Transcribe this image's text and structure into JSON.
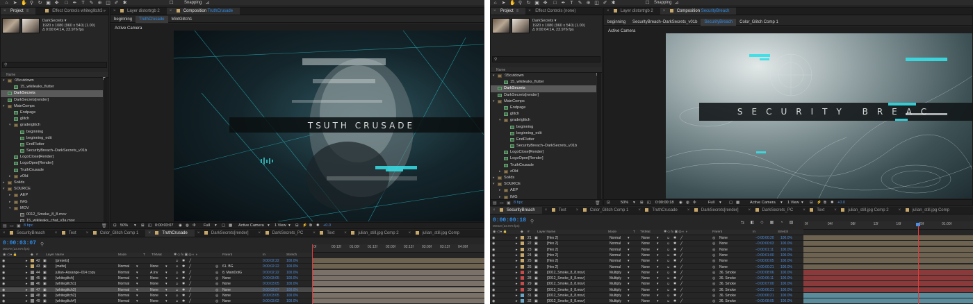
{
  "toolbar": {
    "snapping_label": "Snapping"
  },
  "left": {
    "project": {
      "tabs": [
        {
          "label": "Project",
          "active": true
        },
        {
          "label": "Effect Controls whiteglitch3",
          "active": false
        }
      ],
      "selected_item": "DarkSecrets ▾",
      "item_meta": [
        "1920 x 1080  (960 x 540) (1.00)",
        "Δ 0:00:04:14, 23.976 fps"
      ],
      "name_header": "Name",
      "tree": [
        {
          "depth": 0,
          "type": "folder",
          "twirl": "▾",
          "name": ":15cutdown"
        },
        {
          "depth": 1,
          "type": "comp",
          "twirl": "",
          "name": "15_wikileaks_flutter"
        },
        {
          "depth": 0,
          "type": "comp",
          "twirl": "",
          "name": "DarkSecrets",
          "selected": true
        },
        {
          "depth": 0,
          "type": "comp",
          "twirl": "",
          "name": "DarkSecrets[render]"
        },
        {
          "depth": 0,
          "type": "folder",
          "twirl": "▾",
          "name": "MainComps"
        },
        {
          "depth": 1,
          "type": "comp",
          "twirl": "",
          "name": "Endpage"
        },
        {
          "depth": 1,
          "type": "comp",
          "twirl": "",
          "name": "glitch"
        },
        {
          "depth": 1,
          "type": "folder",
          "twirl": "▾",
          "name": "grade/glitch"
        },
        {
          "depth": 2,
          "type": "comp",
          "twirl": "",
          "name": "beginning"
        },
        {
          "depth": 2,
          "type": "comp",
          "twirl": "",
          "name": "beginning_edit"
        },
        {
          "depth": 2,
          "type": "comp",
          "twirl": "",
          "name": "EndFlutter"
        },
        {
          "depth": 2,
          "type": "comp",
          "twirl": "",
          "name": "SecurityBreach–DarkSecrets_v01b"
        },
        {
          "depth": 1,
          "type": "comp",
          "twirl": "",
          "name": "LogoClose[Render]"
        },
        {
          "depth": 1,
          "type": "comp",
          "twirl": "",
          "name": "LogoOpen[Render]"
        },
        {
          "depth": 1,
          "type": "comp",
          "twirl": "",
          "name": "TruthCrusade"
        },
        {
          "depth": 1,
          "type": "folder",
          "twirl": "▸",
          "name": "zOld"
        },
        {
          "depth": 0,
          "type": "folder",
          "twirl": "▸",
          "name": "Solids"
        },
        {
          "depth": 0,
          "type": "folder",
          "twirl": "▾",
          "name": "SOURCE"
        },
        {
          "depth": 1,
          "type": "folder",
          "twirl": "▸",
          "name": "AEP"
        },
        {
          "depth": 1,
          "type": "folder",
          "twirl": "▸",
          "name": "IMG"
        },
        {
          "depth": 1,
          "type": "folder",
          "twirl": "▾",
          "name": "MOV"
        },
        {
          "depth": 2,
          "type": "footage",
          "twirl": "",
          "name": "0012_Smoke_8_8.mov"
        },
        {
          "depth": 2,
          "type": "footage",
          "twirl": "",
          "name": "15_wikileaks_chat_v3a.mov"
        }
      ],
      "bpc": "8 bpc"
    },
    "viewer": {
      "tabs": [
        {
          "label": "Layer distortrgb 2",
          "active": false,
          "comp": false
        },
        {
          "label": "Composition ",
          "hl": "TruthCrusade",
          "active": true,
          "comp": true
        }
      ],
      "breadcrumbs": [
        {
          "label": "beginning",
          "current": false
        },
        {
          "label": "TruthCrusade",
          "current": true
        },
        {
          "label": "MintGlitch1",
          "current": false
        }
      ],
      "camera_label": "Active Camera",
      "title_text": "TSUTH CRUSADE",
      "footer": {
        "zoom": "50%",
        "timecode": "0:00:03:07",
        "resolution": "Full",
        "camera": "Active Camera",
        "views": "1 View",
        "exposure": "+0.0"
      }
    },
    "timeline": {
      "tabs": [
        {
          "label": "SecurityBreach",
          "color": "#c8a86a",
          "active": false
        },
        {
          "label": "Text",
          "color": "#c8a86a",
          "active": false
        },
        {
          "label": "Color_Glitch Comp 1",
          "color": "#c8a86a",
          "active": false
        },
        {
          "label": "TruthCrusade",
          "color": "#c8a86a",
          "active": true
        },
        {
          "label": "DarkSecrets[render]",
          "color": "#c8a86a",
          "active": false
        },
        {
          "label": "DarkSecrets_PC",
          "color": "#c8a86a",
          "active": false
        },
        {
          "label": "Text",
          "color": "#c8a86a",
          "active": false
        },
        {
          "label": "julian_still.jpg Comp 2",
          "color": "#c8a86a",
          "active": false
        },
        {
          "label": "julian_still.jpg Comp",
          "color": "#c8a86a",
          "active": false
        }
      ],
      "timecode": "0:00:03:07",
      "frames": "00079 (23.976 fps)",
      "columns": {
        "name": "Layer Name",
        "mode": "Mode",
        "t": "T",
        "trkmat": "TrkMat",
        "parent": "Parent",
        "in": "In",
        "stretch": "Stretch"
      },
      "ruler": [
        "0f",
        "00:12f",
        "01:00f",
        "01:12f",
        "02:00f",
        "02:12f",
        "03:00f",
        "03:12f",
        "04:00f"
      ],
      "layers": [
        {
          "num": "42",
          "label": "#c8a86a",
          "name": "[presets]",
          "mode": "",
          "trk": "",
          "parent": "",
          "in": "0:00:02:22",
          "stretch": "100.0%",
          "color": "#6e6250"
        },
        {
          "num": "43",
          "label": "#c8a86a",
          "name": "[matte]",
          "mode": "Normal",
          "trk": "None",
          "parent": "61. BG",
          "in": "0:00:02:22",
          "stretch": "100.0%",
          "color": "#6e6250"
        },
        {
          "num": "44",
          "label": "#8a8a8a",
          "name": "julian–Assange–014 copy",
          "mode": "Normal",
          "trk": "A.Inv",
          "parent": "8. MainDotG",
          "in": "0:00:02:22",
          "stretch": "100.0%",
          "color": "#7a7268"
        },
        {
          "num": "45",
          "label": "#8a8a8a",
          "name": "[whiteglitch]",
          "mode": "Normal",
          "trk": "None",
          "parent": "None",
          "in": "0:00:03:05",
          "stretch": "100.0%",
          "color": "#7a7268"
        },
        {
          "num": "46",
          "label": "#8a8a8a",
          "name": "[whiteglitch1]",
          "mode": "Normal",
          "trk": "None",
          "parent": "None",
          "in": "0:00:03:05",
          "stretch": "100.0%",
          "color": "#7a7268"
        },
        {
          "num": "47",
          "label": "#8a8a8a",
          "name": "[whiteglitch3]",
          "mode": "Normal",
          "trk": "None",
          "parent": "None",
          "in": "0:00:03:07",
          "stretch": "100.0%",
          "color": "#8c8478",
          "selected": true
        },
        {
          "num": "48",
          "label": "#8a8a8a",
          "name": "[whiteglitch2]",
          "mode": "Normal",
          "trk": "None",
          "parent": "None",
          "in": "0:00:03:05",
          "stretch": "100.0%",
          "color": "#7a7268"
        },
        {
          "num": "49",
          "label": "#8a8a8a",
          "name": "[whiteglitch4]",
          "mode": "Normal",
          "trk": "None",
          "parent": "None",
          "in": "0:00:03:02",
          "stretch": "100.0%",
          "color": "#7a7268"
        }
      ]
    }
  },
  "right": {
    "project": {
      "tabs": [
        {
          "label": "Project",
          "active": true
        },
        {
          "label": "Effect Controls (none)",
          "active": false
        }
      ],
      "selected_item": "DarkSecrets ▾",
      "item_meta": [
        "1920 x 1080  (960 x 540) (1.00)",
        "Δ 0:00:04:14, 23.976 fps"
      ],
      "name_header": "Name",
      "tree": [
        {
          "depth": 0,
          "type": "folder",
          "twirl": "▾",
          "name": ":15cutdown"
        },
        {
          "depth": 1,
          "type": "comp",
          "twirl": "",
          "name": "15_wikileaks_flutter"
        },
        {
          "depth": 0,
          "type": "comp",
          "twirl": "",
          "name": "DarkSecrets",
          "selected": true
        },
        {
          "depth": 0,
          "type": "comp",
          "twirl": "",
          "name": "DarkSecrets[render]"
        },
        {
          "depth": 0,
          "type": "folder",
          "twirl": "▾",
          "name": "MainComps"
        },
        {
          "depth": 1,
          "type": "comp",
          "twirl": "",
          "name": "Endpage"
        },
        {
          "depth": 1,
          "type": "comp",
          "twirl": "",
          "name": "glitch"
        },
        {
          "depth": 1,
          "type": "folder",
          "twirl": "▾",
          "name": "grade/glitch"
        },
        {
          "depth": 2,
          "type": "comp",
          "twirl": "",
          "name": "beginning"
        },
        {
          "depth": 2,
          "type": "comp",
          "twirl": "",
          "name": "beginning_edit"
        },
        {
          "depth": 2,
          "type": "comp",
          "twirl": "",
          "name": "EndFlutter"
        },
        {
          "depth": 2,
          "type": "comp",
          "twirl": "",
          "name": "SecurityBreach–DarkSecrets_v01b"
        },
        {
          "depth": 1,
          "type": "comp",
          "twirl": "",
          "name": "LogoClose[Render]"
        },
        {
          "depth": 1,
          "type": "comp",
          "twirl": "",
          "name": "LogoOpen[Render]"
        },
        {
          "depth": 1,
          "type": "comp",
          "twirl": "",
          "name": "TruthCrusade"
        },
        {
          "depth": 1,
          "type": "folder",
          "twirl": "▸",
          "name": "zOld"
        },
        {
          "depth": 0,
          "type": "folder",
          "twirl": "▸",
          "name": "Solids"
        },
        {
          "depth": 0,
          "type": "folder",
          "twirl": "▾",
          "name": "SOURCE"
        },
        {
          "depth": 1,
          "type": "folder",
          "twirl": "▸",
          "name": "AEP"
        },
        {
          "depth": 1,
          "type": "folder",
          "twirl": "▸",
          "name": "IMG"
        }
      ],
      "bpc": "8 bpc"
    },
    "viewer": {
      "tabs": [
        {
          "label": "Layer distortrgb 2",
          "active": false,
          "comp": false
        },
        {
          "label": "Composition ",
          "hl": "SecurityBreach",
          "active": true,
          "comp": true
        }
      ],
      "breadcrumbs": [
        {
          "label": "beginning",
          "current": false
        },
        {
          "label": "SecurityBreach–DarkSecrets_v01b",
          "current": false
        },
        {
          "label": "SecurityBreach",
          "current": true
        },
        {
          "label": "Color_Glitch Comp 1",
          "current": false
        }
      ],
      "camera_label": "Active Camera",
      "title_text": "SECURITY BREAC",
      "footer": {
        "zoom": "50%",
        "timecode": "0:00:00:18",
        "resolution": "Full",
        "camera": "Active Camera",
        "views": "1 View",
        "exposure": "+0.0"
      }
    },
    "timeline": {
      "tabs": [
        {
          "label": "SecurityBreach",
          "color": "#c8a86a",
          "active": true
        },
        {
          "label": "Text",
          "color": "#c8a86a",
          "active": false
        },
        {
          "label": "Color_Glitch Comp 1",
          "color": "#c8a86a",
          "active": false
        },
        {
          "label": "TruthCrusade",
          "color": "#c8a86a",
          "active": false
        },
        {
          "label": "DarkSecrets[render]",
          "color": "#c8a86a",
          "active": false
        },
        {
          "label": "DarkSecrets_PC",
          "color": "#c8a86a",
          "active": false
        },
        {
          "label": "Text",
          "color": "#c8a86a",
          "active": false
        },
        {
          "label": "julian_still.jpg Comp 2",
          "color": "#c8a86a",
          "active": false
        },
        {
          "label": "julian_still.jpg Comp",
          "color": "#c8a86a",
          "active": false
        }
      ],
      "timecode": "0:00:00:18",
      "frames": "00018 (23.976 fps)",
      "columns": {
        "name": "Layer Name",
        "mode": "Mode",
        "t": "T",
        "trkmat": "TrkMat",
        "parent": "Parent",
        "in": "In",
        "stretch": "Stretch"
      },
      "ruler": [
        "0f",
        "04f",
        "08f",
        "12f",
        "16f",
        "20f",
        "01:00f"
      ],
      "layers": [
        {
          "num": "21",
          "label": "#c8a86a",
          "name": "[Hex 2]",
          "mode": "Normal",
          "trk": "None",
          "parent": "None",
          "in": "−0:00:00:20",
          "stretch": "100.0%",
          "color": "#6e6250"
        },
        {
          "num": "22",
          "label": "#c8a86a",
          "name": "[Hex 2]",
          "mode": "Normal",
          "trk": "None",
          "parent": "None",
          "in": "−0:00:00:03",
          "stretch": "100.0%",
          "color": "#6e6250"
        },
        {
          "num": "23",
          "label": "#c8a86a",
          "name": "[Hex 2]",
          "mode": "Normal",
          "trk": "None",
          "parent": "None",
          "in": "−0:00:01:11",
          "stretch": "100.0%",
          "color": "#6e6250"
        },
        {
          "num": "24",
          "label": "#c8a86a",
          "name": "[Hex 2]",
          "mode": "Normal",
          "trk": "None",
          "parent": "None",
          "in": "−0:00:01:00",
          "stretch": "100.0%",
          "color": "#6e6250"
        },
        {
          "num": "25",
          "label": "#c8a86a",
          "name": "[Hex 2]",
          "mode": "Normal",
          "trk": "None",
          "parent": "None",
          "in": "−0:00:00:05",
          "stretch": "100.0%",
          "color": "#6e6250"
        },
        {
          "num": "26",
          "label": "#c8a86a",
          "name": "[Hex 2]",
          "mode": "Normal",
          "trk": "None",
          "parent": "None",
          "in": "−0:00:00:21",
          "stretch": "100.0%",
          "color": "#6e6250"
        },
        {
          "num": "27",
          "label": "#c84a4a",
          "name": "[0012_Smoke_8_8.mov]",
          "mode": "Multiply",
          "trk": "None",
          "parent": "36. Smoke",
          "in": "−0:00:08:06",
          "stretch": "100.0%",
          "color": "#8a3a3a"
        },
        {
          "num": "28",
          "label": "#c84a4a",
          "name": "[0012_Smoke_8_8.mov]",
          "mode": "Multiply",
          "trk": "None",
          "parent": "36. Smoke",
          "in": "−0:00:06:11",
          "stretch": "100.0%",
          "color": "#8a3a3a"
        },
        {
          "num": "29",
          "label": "#c84a4a",
          "name": "[0012_Smoke_8_8.mov]",
          "mode": "Multiply",
          "trk": "None",
          "parent": "36. Smoke",
          "in": "−0:00:07:00",
          "stretch": "100.0%",
          "color": "#8a3a3a"
        },
        {
          "num": "30",
          "label": "#c84a4a",
          "name": "[0012_Smoke_8_8.mov]",
          "mode": "Multiply",
          "trk": "None",
          "parent": "36. Smoke",
          "in": "−0:00:06:21",
          "stretch": "100.0%",
          "color": "#8a3a3a"
        },
        {
          "num": "31",
          "label": "#6aa6c8",
          "name": "[0012_Smoke_8_8.mov]",
          "mode": "Multiply",
          "trk": "None",
          "parent": "36. Smoke",
          "in": "−0:00:06:21",
          "stretch": "100.0%",
          "color": "#5a8c9c"
        },
        {
          "num": "32",
          "label": "#6aa6c8",
          "name": "[0012_Smoke_8_8.mov]",
          "mode": "Multiply",
          "trk": "None",
          "parent": "36. Smoke",
          "in": "−0:00:08:05",
          "stretch": "100.0%",
          "color": "#5a8c9c"
        }
      ]
    }
  }
}
